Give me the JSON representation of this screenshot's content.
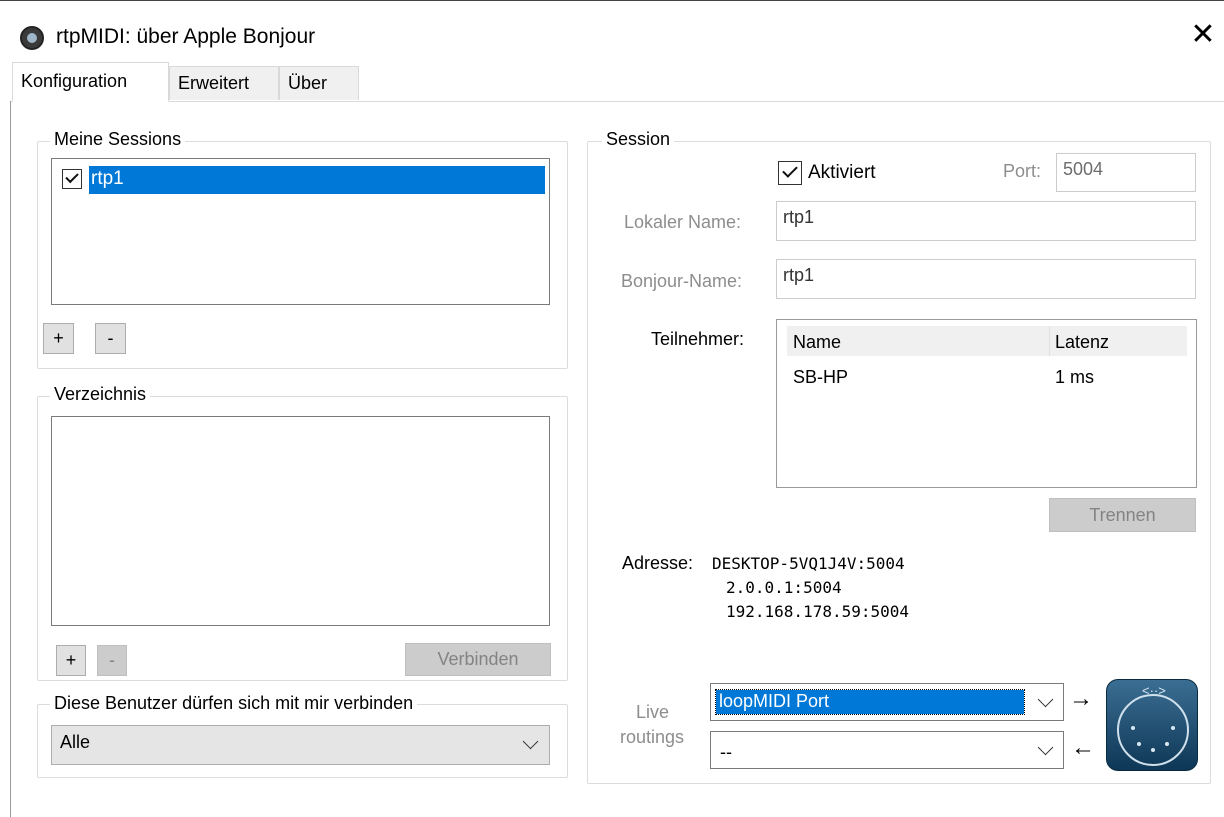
{
  "window": {
    "title": "rtpMIDI: über Apple Bonjour",
    "close_symbol": "✕"
  },
  "tabs": [
    {
      "label": "Konfiguration",
      "active": true
    },
    {
      "label": "Erweitert",
      "active": false
    },
    {
      "label": "Über",
      "active": false
    }
  ],
  "sessions_group": {
    "label": "Meine Sessions",
    "items": [
      {
        "label": "rtp1",
        "checked": true,
        "selected": true
      }
    ],
    "add_label": "+",
    "remove_label": "-"
  },
  "directory_group": {
    "label": "Verzeichnis",
    "add_label": "+",
    "remove_label": "-",
    "connect_label": "Verbinden"
  },
  "users_group": {
    "label": "Diese Benutzer dürfen sich mit mir verbinden",
    "selected": "Alle"
  },
  "session": {
    "label": "Session",
    "enabled_label": "Aktiviert",
    "enabled": true,
    "port_label": "Port:",
    "port_value": "5004",
    "local_name_label": "Lokaler Name:",
    "local_name_value": "rtp1",
    "bonjour_name_label": "Bonjour-Name:",
    "bonjour_name_value": "rtp1",
    "participants_label": "Teilnehmer:",
    "participants_columns": [
      "Name",
      "Latenz"
    ],
    "participants": [
      {
        "name": "SB-HP",
        "latency": "1 ms"
      }
    ],
    "disconnect_label": "Trennen",
    "address_label": "Adresse:",
    "addresses": [
      "DESKTOP-5VQ1J4V:5004",
      "2.0.0.1:5004",
      "192.168.178.59:5004"
    ],
    "live_label_1": "Live",
    "live_label_2": "routings",
    "route_out": "loopMIDI Port",
    "route_in": "--",
    "arrow_out": "→",
    "arrow_in": "←"
  },
  "colors": {
    "selection": "#0078d7",
    "disabled_text": "#8d8d8d"
  }
}
